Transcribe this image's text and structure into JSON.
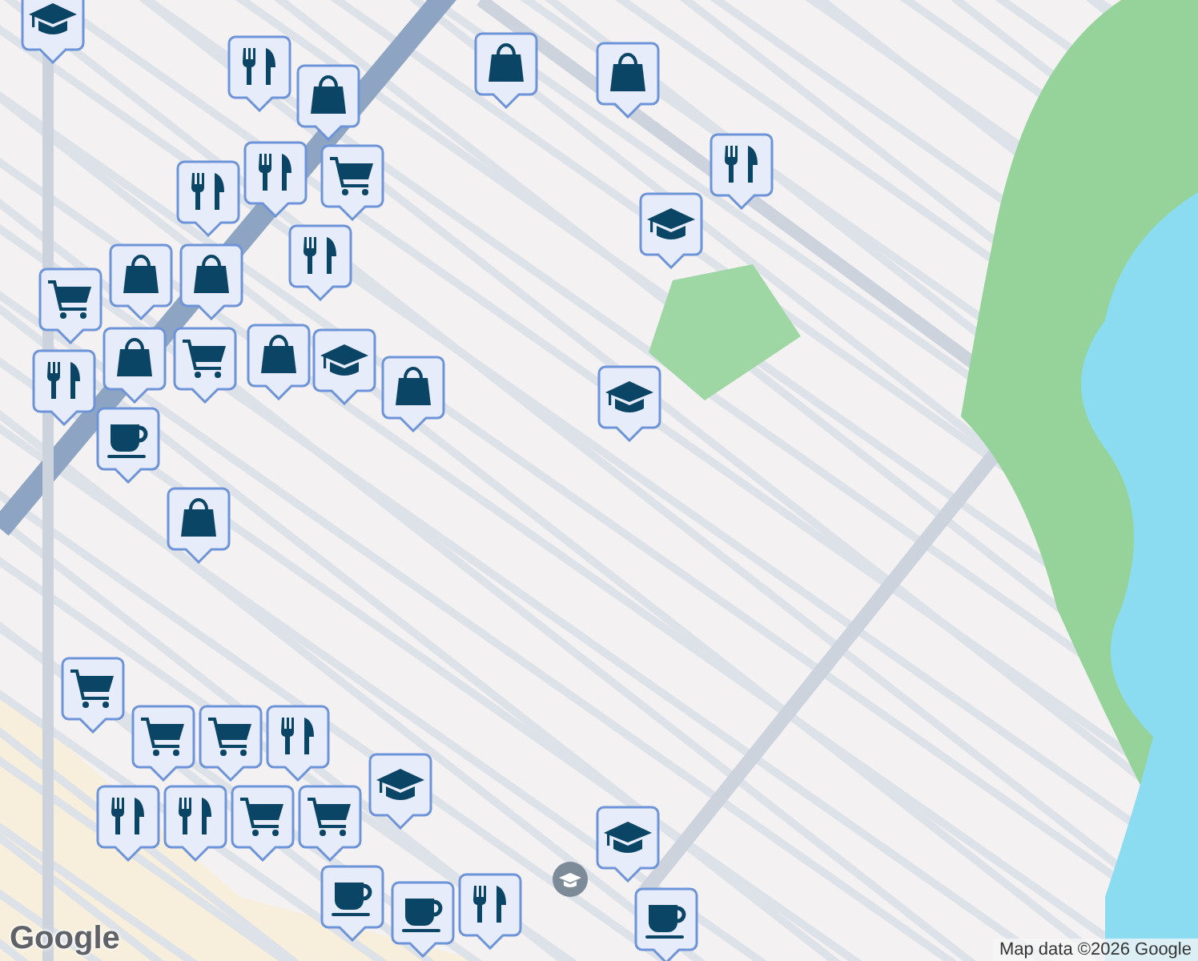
{
  "map": {
    "markers": [
      {
        "kind": "school"
      },
      {
        "kind": "restaurant"
      },
      {
        "kind": "bag"
      },
      {
        "kind": "cart"
      },
      {
        "kind": "restaurant"
      },
      {
        "kind": "restaurant"
      },
      {
        "kind": "restaurant"
      },
      {
        "kind": "cart"
      },
      {
        "kind": "bag"
      },
      {
        "kind": "bag"
      },
      {
        "kind": "bag"
      },
      {
        "kind": "restaurant"
      },
      {
        "kind": "bag"
      },
      {
        "kind": "cart"
      },
      {
        "kind": "cafe"
      },
      {
        "kind": "school"
      },
      {
        "kind": "bag"
      },
      {
        "kind": "bag"
      },
      {
        "kind": "bag"
      },
      {
        "kind": "bag"
      },
      {
        "kind": "restaurant"
      },
      {
        "kind": "school"
      },
      {
        "kind": "school"
      },
      {
        "kind": "cart"
      },
      {
        "kind": "cart"
      },
      {
        "kind": "cart"
      },
      {
        "kind": "restaurant"
      },
      {
        "kind": "restaurant"
      },
      {
        "kind": "restaurant"
      },
      {
        "kind": "cart"
      },
      {
        "kind": "cart"
      },
      {
        "kind": "school"
      },
      {
        "kind": "cafe"
      },
      {
        "kind": "cafe"
      },
      {
        "kind": "restaurant"
      },
      {
        "kind": "cafe"
      },
      {
        "kind": "school"
      }
    ]
  },
  "logo": "Google",
  "attribution": "Map data ©2026 Google"
}
